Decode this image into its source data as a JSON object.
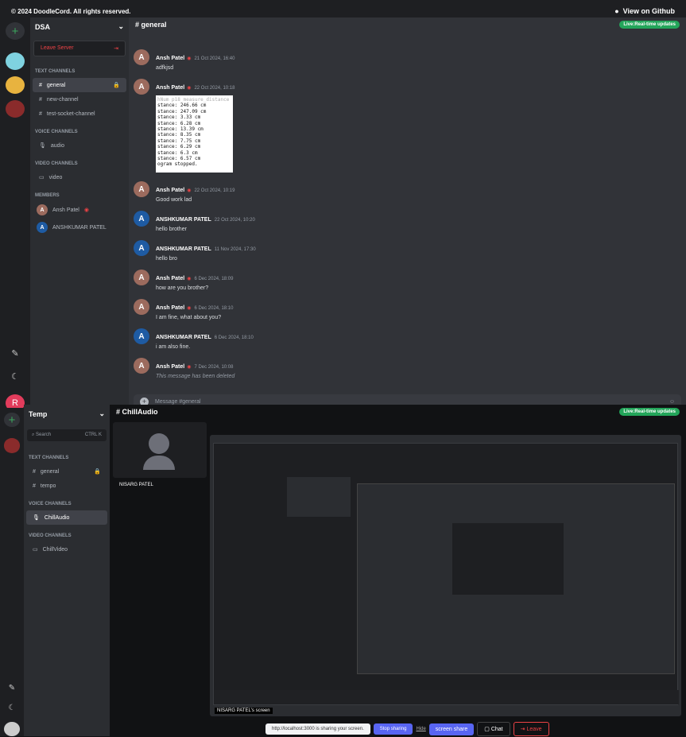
{
  "topbar": {
    "copyright": "© 2024 DoodleCord. All rights reserved.",
    "github": "View on Github"
  },
  "server1": {
    "name": "DSA",
    "leave": "Leave Server",
    "cat_text": "TEXT CHANNELS",
    "text_channels": [
      "general",
      "new-channel",
      "test-socket-channel"
    ],
    "cat_voice": "VOICE CHANNELS",
    "voice_channels": [
      "audio"
    ],
    "cat_video": "VIDEO CHANNELS",
    "video_channels": [
      "video"
    ],
    "cat_members": "MEMBERS",
    "members": [
      "Ansh Patel",
      "ANSHKUMAR PATEL"
    ]
  },
  "chat": {
    "channel": "general",
    "live": "Live:Real-time updates",
    "placeholder": "Message #general",
    "messages": [
      {
        "author": "Ansh Patel",
        "date": "21 Oct 2024, 16:40",
        "text": "adfkjsd"
      },
      {
        "author": "Ansh Patel",
        "date": "22 Oct 2024, 10:18",
        "text": ""
      },
      {
        "author": "Ansh Patel",
        "date": "22 Oct 2024, 10:19",
        "text": "Good work lad"
      },
      {
        "author": "ANSHKUMAR PATEL",
        "date": "22 Oct 2024, 10:20",
        "text": "hello brother"
      },
      {
        "author": "ANSHKUMAR PATEL",
        "date": "11 Nov 2024, 17:30",
        "text": "hello bro"
      },
      {
        "author": "Ansh Patel",
        "date": "6 Dec 2024, 18:09",
        "text": "how are you brother?"
      },
      {
        "author": "Ansh Patel",
        "date": "6 Dec 2024, 18:10",
        "text": "I am fine, what about you?"
      },
      {
        "author": "ANSHKUMAR PATEL",
        "date": "6 Dec 2024, 18:10",
        "text": "i am also fine."
      },
      {
        "author": "Ansh Patel",
        "date": "7 Dec 2024, 10:08",
        "text": "This message has been deleted"
      }
    ],
    "code_lines": [
      "hNum p18_measure_distance",
      "stance: 246.66 cm",
      "stance: 247.09 cm",
      "stance: 3.33 cm",
      "stance: 6.28 cm",
      "stance: 13.39 cm",
      "stance: 8.35 cm",
      "stance: 7.75 cm",
      "stance: 6.29 cm",
      "stance: 6.3 cm",
      "stance: 6.57 cm",
      "ogram stopped."
    ]
  },
  "server2": {
    "name": "Temp",
    "search": "Search",
    "shortcut": "CTRL K",
    "cat_text": "TEXT CHANNELS",
    "text_channels": [
      "general",
      "tempo"
    ],
    "cat_voice": "VOICE CHANNELS",
    "voice_channels": [
      "ChillAudio"
    ],
    "cat_video": "VIDEO CHANNELS",
    "video_channels": [
      "ChillVideo"
    ]
  },
  "voice": {
    "channel": "ChillAudio",
    "live": "Live:Real-time updates",
    "participant": "NISARG PATEL",
    "screen_label": "NISARG PATEL's screen",
    "share_notice": "http://localhost:3000 is sharing your screen.",
    "stop": "Stop sharing",
    "hide": "Hide",
    "screen_share": "screen share",
    "chat": "Chat",
    "leave": "Leave"
  },
  "colors": {
    "green": "#23a55a",
    "red": "#ed4245",
    "blurple": "#5865f2"
  }
}
